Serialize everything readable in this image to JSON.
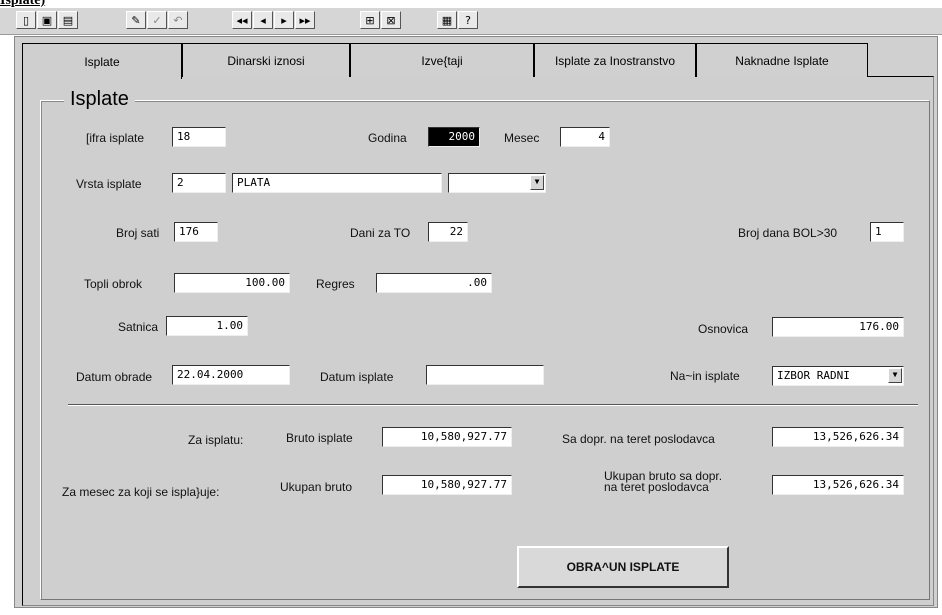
{
  "window": {
    "title_fragment": "Isplate)"
  },
  "toolbar": {
    "groups": [
      {
        "name": "file",
        "buttons": [
          {
            "icon": "document-icon",
            "glyph": "▯"
          },
          {
            "icon": "save-icon",
            "glyph": "▣"
          },
          {
            "icon": "print-icon",
            "glyph": "▤"
          }
        ]
      },
      {
        "name": "edit",
        "buttons": [
          {
            "icon": "edit-icon",
            "glyph": "✎"
          },
          {
            "icon": "check-icon",
            "glyph": "✓"
          },
          {
            "icon": "undo-icon",
            "glyph": "↶"
          }
        ]
      },
      {
        "name": "nav",
        "buttons": [
          {
            "icon": "first-record-icon",
            "glyph": "◂◂"
          },
          {
            "icon": "prev-record-icon",
            "glyph": "◂"
          },
          {
            "icon": "next-record-icon",
            "glyph": "▸"
          },
          {
            "icon": "last-record-icon",
            "glyph": "▸▸"
          }
        ]
      },
      {
        "name": "records",
        "buttons": [
          {
            "icon": "insert-record-icon",
            "glyph": "⊞"
          },
          {
            "icon": "delete-record-icon",
            "glyph": "⊠"
          }
        ]
      },
      {
        "name": "help",
        "buttons": [
          {
            "icon": "clipboard-icon",
            "glyph": "▦"
          },
          {
            "icon": "help-icon",
            "glyph": "?"
          }
        ]
      }
    ]
  },
  "tabs": [
    "Isplate",
    "Dinarski iznosi",
    "Izve{taji",
    "Isplate za Inostranstvo",
    "Naknadne Isplate"
  ],
  "group_title": "Isplate",
  "form": {
    "sifra_label": "[ifra isplate",
    "sifra_value": "18",
    "godina_label": "Godina",
    "godina_value": "2000",
    "mesec_label": "Mesec",
    "mesec_value": "4",
    "vrsta_label": "Vrsta isplate",
    "vrsta_code": "2",
    "vrsta_name": "PLATA",
    "vrsta_combo": "",
    "brojsati_label": "Broj sati",
    "brojsati_value": "176",
    "danito_label": "Dani za TO",
    "danito_value": "22",
    "bol_label": "Broj dana BOL>30",
    "bol_value": "1",
    "topli_label": "Topli obrok",
    "topli_value": "100.00",
    "regres_label": "Regres",
    "regres_value": ".00",
    "satnica_label": "Satnica",
    "satnica_value": "1.00",
    "osnovica_label": "Osnovica",
    "osnovica_value": "176.00",
    "dobrade_label": "Datum obrade",
    "dobrade_value": "22.04.2000",
    "displate_label": "Datum isplate",
    "displate_value": "",
    "nacin_label": "Na~in isplate",
    "nacin_value": "IZBOR RADNI"
  },
  "summary": {
    "za_isplatu_label": "Za isplatu:",
    "bruto_isplate_label": "Bruto isplate",
    "bruto_isplate_value": "10,580,927.77",
    "sa_dopr_label": "Sa dopr. na teret poslodavca",
    "sa_dopr_value": "13,526,626.34",
    "za_mesec_label": "Za mesec za koji se ispla}uje:",
    "ukupan_bruto_label": "Ukupan bruto",
    "ukupan_bruto_value": "10,580,927.77",
    "ukupan_dopr_label_1": "Ukupan bruto sa dopr.",
    "ukupan_dopr_label_2": "na teret poslodavca",
    "ukupan_dopr_value": "13,526,626.34"
  },
  "action_button": "OBRA^UN ISPLATE"
}
